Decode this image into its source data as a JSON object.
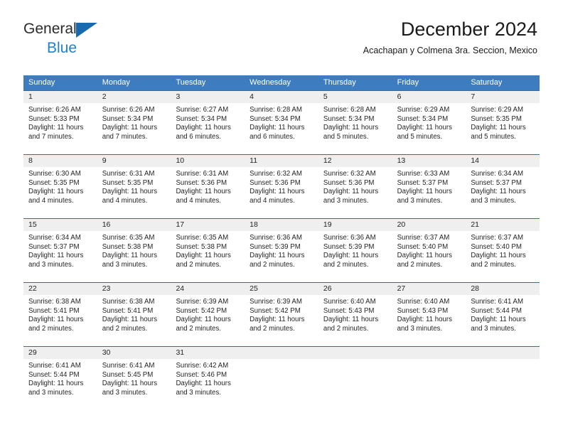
{
  "brand": {
    "name_line1": "General",
    "name_line2": "Blue",
    "flag_icon": "triangle-flag-icon",
    "accent_color": "#1769b0",
    "blue_text_color": "#1f7fd0"
  },
  "header": {
    "title": "December 2024",
    "subtitle": "Acachapan y Colmena 3ra. Seccion, Mexico"
  },
  "calendar": {
    "header_bg": "#3d7dbf",
    "day_band_bg": "#efefef",
    "cell_border_color": "#2f6ba6",
    "weekdays": [
      "Sunday",
      "Monday",
      "Tuesday",
      "Wednesday",
      "Thursday",
      "Friday",
      "Saturday"
    ],
    "weeks": [
      [
        {
          "day": "1",
          "sunrise": "Sunrise: 6:26 AM",
          "sunset": "Sunset: 5:33 PM",
          "daylight_line1": "Daylight: 11 hours",
          "daylight_line2": "and 7 minutes."
        },
        {
          "day": "2",
          "sunrise": "Sunrise: 6:26 AM",
          "sunset": "Sunset: 5:34 PM",
          "daylight_line1": "Daylight: 11 hours",
          "daylight_line2": "and 7 minutes."
        },
        {
          "day": "3",
          "sunrise": "Sunrise: 6:27 AM",
          "sunset": "Sunset: 5:34 PM",
          "daylight_line1": "Daylight: 11 hours",
          "daylight_line2": "and 6 minutes."
        },
        {
          "day": "4",
          "sunrise": "Sunrise: 6:28 AM",
          "sunset": "Sunset: 5:34 PM",
          "daylight_line1": "Daylight: 11 hours",
          "daylight_line2": "and 6 minutes."
        },
        {
          "day": "5",
          "sunrise": "Sunrise: 6:28 AM",
          "sunset": "Sunset: 5:34 PM",
          "daylight_line1": "Daylight: 11 hours",
          "daylight_line2": "and 5 minutes."
        },
        {
          "day": "6",
          "sunrise": "Sunrise: 6:29 AM",
          "sunset": "Sunset: 5:34 PM",
          "daylight_line1": "Daylight: 11 hours",
          "daylight_line2": "and 5 minutes."
        },
        {
          "day": "7",
          "sunrise": "Sunrise: 6:29 AM",
          "sunset": "Sunset: 5:35 PM",
          "daylight_line1": "Daylight: 11 hours",
          "daylight_line2": "and 5 minutes."
        }
      ],
      [
        {
          "day": "8",
          "sunrise": "Sunrise: 6:30 AM",
          "sunset": "Sunset: 5:35 PM",
          "daylight_line1": "Daylight: 11 hours",
          "daylight_line2": "and 4 minutes."
        },
        {
          "day": "9",
          "sunrise": "Sunrise: 6:31 AM",
          "sunset": "Sunset: 5:35 PM",
          "daylight_line1": "Daylight: 11 hours",
          "daylight_line2": "and 4 minutes."
        },
        {
          "day": "10",
          "sunrise": "Sunrise: 6:31 AM",
          "sunset": "Sunset: 5:36 PM",
          "daylight_line1": "Daylight: 11 hours",
          "daylight_line2": "and 4 minutes."
        },
        {
          "day": "11",
          "sunrise": "Sunrise: 6:32 AM",
          "sunset": "Sunset: 5:36 PM",
          "daylight_line1": "Daylight: 11 hours",
          "daylight_line2": "and 4 minutes."
        },
        {
          "day": "12",
          "sunrise": "Sunrise: 6:32 AM",
          "sunset": "Sunset: 5:36 PM",
          "daylight_line1": "Daylight: 11 hours",
          "daylight_line2": "and 3 minutes."
        },
        {
          "day": "13",
          "sunrise": "Sunrise: 6:33 AM",
          "sunset": "Sunset: 5:37 PM",
          "daylight_line1": "Daylight: 11 hours",
          "daylight_line2": "and 3 minutes."
        },
        {
          "day": "14",
          "sunrise": "Sunrise: 6:34 AM",
          "sunset": "Sunset: 5:37 PM",
          "daylight_line1": "Daylight: 11 hours",
          "daylight_line2": "and 3 minutes."
        }
      ],
      [
        {
          "day": "15",
          "sunrise": "Sunrise: 6:34 AM",
          "sunset": "Sunset: 5:37 PM",
          "daylight_line1": "Daylight: 11 hours",
          "daylight_line2": "and 3 minutes."
        },
        {
          "day": "16",
          "sunrise": "Sunrise: 6:35 AM",
          "sunset": "Sunset: 5:38 PM",
          "daylight_line1": "Daylight: 11 hours",
          "daylight_line2": "and 3 minutes."
        },
        {
          "day": "17",
          "sunrise": "Sunrise: 6:35 AM",
          "sunset": "Sunset: 5:38 PM",
          "daylight_line1": "Daylight: 11 hours",
          "daylight_line2": "and 2 minutes."
        },
        {
          "day": "18",
          "sunrise": "Sunrise: 6:36 AM",
          "sunset": "Sunset: 5:39 PM",
          "daylight_line1": "Daylight: 11 hours",
          "daylight_line2": "and 2 minutes."
        },
        {
          "day": "19",
          "sunrise": "Sunrise: 6:36 AM",
          "sunset": "Sunset: 5:39 PM",
          "daylight_line1": "Daylight: 11 hours",
          "daylight_line2": "and 2 minutes."
        },
        {
          "day": "20",
          "sunrise": "Sunrise: 6:37 AM",
          "sunset": "Sunset: 5:40 PM",
          "daylight_line1": "Daylight: 11 hours",
          "daylight_line2": "and 2 minutes."
        },
        {
          "day": "21",
          "sunrise": "Sunrise: 6:37 AM",
          "sunset": "Sunset: 5:40 PM",
          "daylight_line1": "Daylight: 11 hours",
          "daylight_line2": "and 2 minutes."
        }
      ],
      [
        {
          "day": "22",
          "sunrise": "Sunrise: 6:38 AM",
          "sunset": "Sunset: 5:41 PM",
          "daylight_line1": "Daylight: 11 hours",
          "daylight_line2": "and 2 minutes."
        },
        {
          "day": "23",
          "sunrise": "Sunrise: 6:38 AM",
          "sunset": "Sunset: 5:41 PM",
          "daylight_line1": "Daylight: 11 hours",
          "daylight_line2": "and 2 minutes."
        },
        {
          "day": "24",
          "sunrise": "Sunrise: 6:39 AM",
          "sunset": "Sunset: 5:42 PM",
          "daylight_line1": "Daylight: 11 hours",
          "daylight_line2": "and 2 minutes."
        },
        {
          "day": "25",
          "sunrise": "Sunrise: 6:39 AM",
          "sunset": "Sunset: 5:42 PM",
          "daylight_line1": "Daylight: 11 hours",
          "daylight_line2": "and 2 minutes."
        },
        {
          "day": "26",
          "sunrise": "Sunrise: 6:40 AM",
          "sunset": "Sunset: 5:43 PM",
          "daylight_line1": "Daylight: 11 hours",
          "daylight_line2": "and 2 minutes."
        },
        {
          "day": "27",
          "sunrise": "Sunrise: 6:40 AM",
          "sunset": "Sunset: 5:43 PM",
          "daylight_line1": "Daylight: 11 hours",
          "daylight_line2": "and 3 minutes."
        },
        {
          "day": "28",
          "sunrise": "Sunrise: 6:41 AM",
          "sunset": "Sunset: 5:44 PM",
          "daylight_line1": "Daylight: 11 hours",
          "daylight_line2": "and 3 minutes."
        }
      ],
      [
        {
          "day": "29",
          "sunrise": "Sunrise: 6:41 AM",
          "sunset": "Sunset: 5:44 PM",
          "daylight_line1": "Daylight: 11 hours",
          "daylight_line2": "and 3 minutes."
        },
        {
          "day": "30",
          "sunrise": "Sunrise: 6:41 AM",
          "sunset": "Sunset: 5:45 PM",
          "daylight_line1": "Daylight: 11 hours",
          "daylight_line2": "and 3 minutes."
        },
        {
          "day": "31",
          "sunrise": "Sunrise: 6:42 AM",
          "sunset": "Sunset: 5:46 PM",
          "daylight_line1": "Daylight: 11 hours",
          "daylight_line2": "and 3 minutes."
        },
        {
          "day": "",
          "sunrise": "",
          "sunset": "",
          "daylight_line1": "",
          "daylight_line2": ""
        },
        {
          "day": "",
          "sunrise": "",
          "sunset": "",
          "daylight_line1": "",
          "daylight_line2": ""
        },
        {
          "day": "",
          "sunrise": "",
          "sunset": "",
          "daylight_line1": "",
          "daylight_line2": ""
        },
        {
          "day": "",
          "sunrise": "",
          "sunset": "",
          "daylight_line1": "",
          "daylight_line2": ""
        }
      ]
    ]
  }
}
